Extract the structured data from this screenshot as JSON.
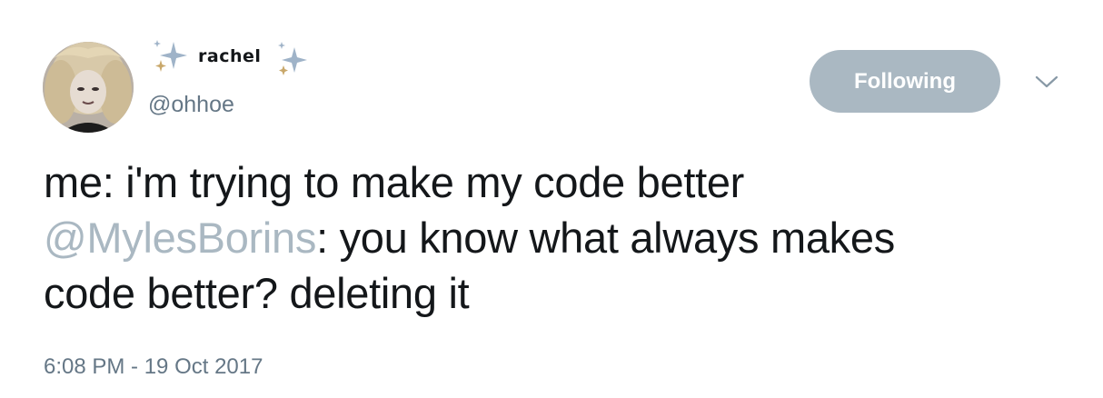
{
  "user": {
    "display_name": "rachel",
    "handle": "@ohhoe",
    "name_decoration": "sparkles-icon"
  },
  "follow_button": {
    "label": "Following"
  },
  "menu": {
    "icon": "chevron-down-icon"
  },
  "tweet": {
    "line1": "me: i'm trying to make my code better",
    "mention": "@MylesBorins",
    "line2_rest": ": you know what always makes",
    "line3": "code better? deleting it"
  },
  "timestamp": "6:08 PM - 19 Oct 2017",
  "colors": {
    "text": "#14171a",
    "secondary": "#657786",
    "button_bg": "#aab8c2",
    "mention": "#aab8c2",
    "sparkle_blue": "#9fb3c8",
    "sparkle_gold": "#c9a86b"
  }
}
